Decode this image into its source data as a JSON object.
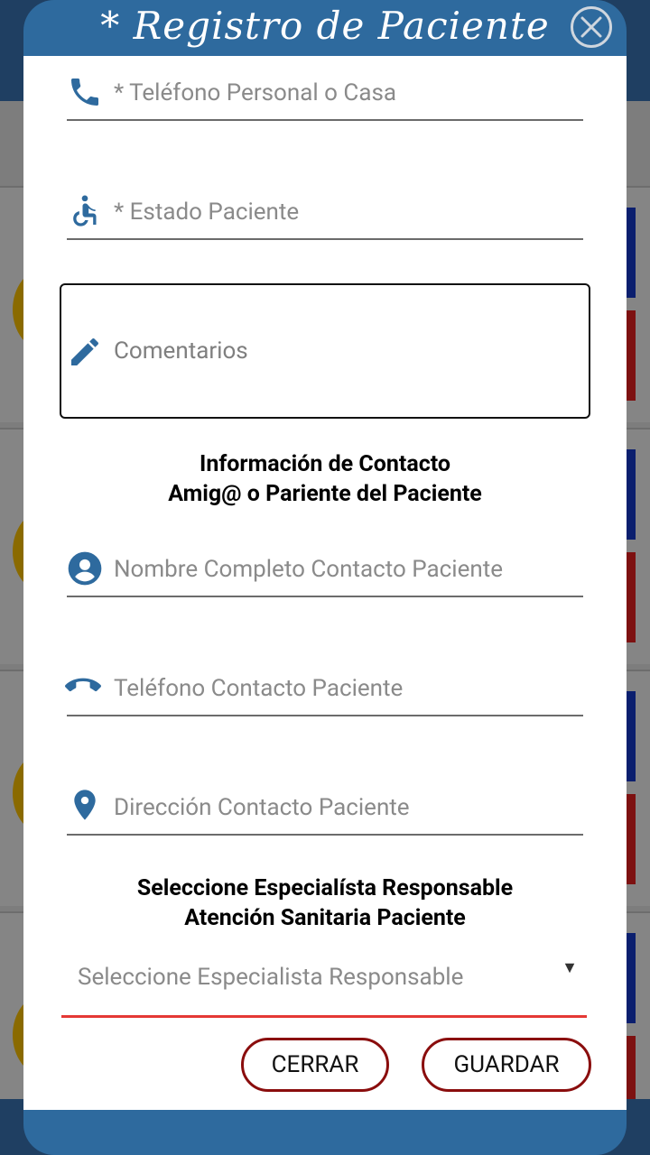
{
  "modal": {
    "title": "* Registro de Paciente",
    "close_icon": "close-circle-icon"
  },
  "fields": {
    "phone_personal": {
      "placeholder": "* Teléfono Personal o Casa",
      "icon": "phone-icon"
    },
    "patient_status": {
      "placeholder": "* Estado Paciente",
      "icon": "wheelchair-icon"
    },
    "comments": {
      "placeholder": "Comentarios",
      "icon": "pencil-icon"
    },
    "contact_name": {
      "placeholder": "Nombre Completo Contacto Paciente",
      "icon": "account-circle-icon"
    },
    "contact_phone": {
      "placeholder": "Teléfono Contacto Paciente",
      "icon": "phone-hangup-icon"
    },
    "contact_address": {
      "placeholder": "Dirección Contacto Paciente",
      "icon": "map-pin-icon"
    }
  },
  "sections": {
    "contact_info_line1": "Información de Contacto",
    "contact_info_line2": "Amig@ o Pariente del Paciente",
    "specialist_line1": "Seleccione Especialísta Responsable",
    "specialist_line2": "Atención Sanitaria Paciente"
  },
  "specialist_select": {
    "selected_text": "Seleccione Especialista Responsable",
    "arrow": "▼"
  },
  "buttons": {
    "close_label": "CERRAR",
    "save_label": "GUARDAR"
  },
  "colors": {
    "header_blue": "#2e6a9e",
    "icon_blue": "#2e6a9e",
    "button_border": "#8a0d0d",
    "select_underline": "#e53935"
  }
}
